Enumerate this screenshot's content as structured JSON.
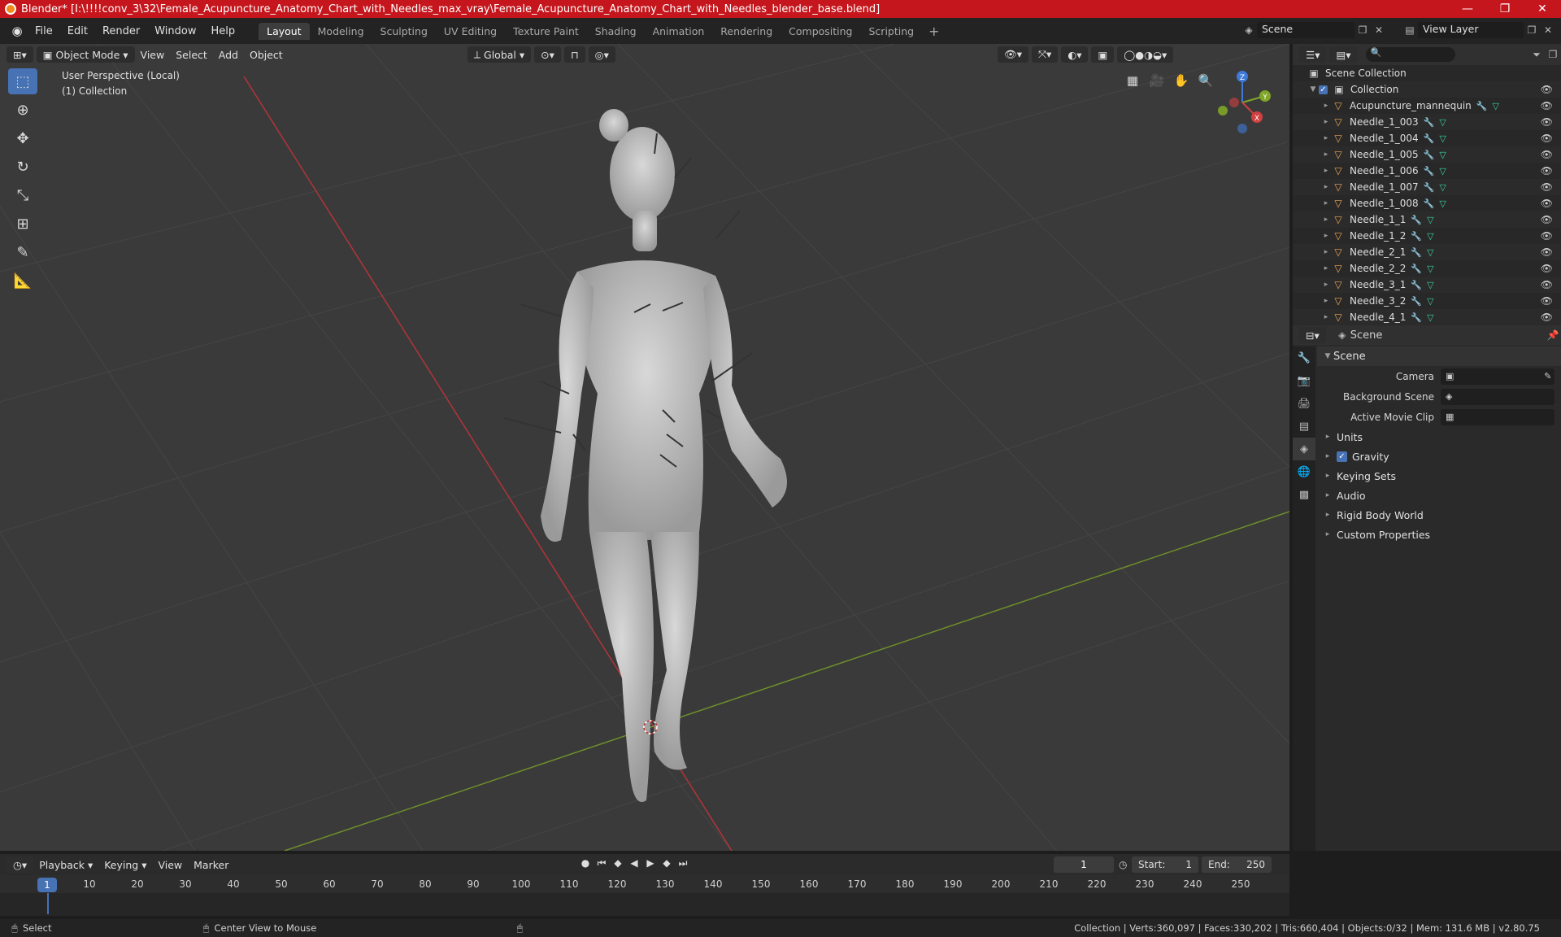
{
  "titlebar": {
    "title": "Blender* [I:\\!!!!conv_3\\32\\Female_Acupuncture_Anatomy_Chart_with_Needles_max_vray\\Female_Acupuncture_Anatomy_Chart_with_Needles_blender_base.blend]",
    "minimize": "—",
    "maximize": "❐",
    "close": "✕"
  },
  "menubar": {
    "items": [
      "File",
      "Edit",
      "Render",
      "Window",
      "Help"
    ],
    "tabs": [
      "Layout",
      "Modeling",
      "Sculpting",
      "UV Editing",
      "Texture Paint",
      "Shading",
      "Animation",
      "Rendering",
      "Compositing",
      "Scripting"
    ],
    "active_tab": "Layout",
    "scene": "Scene",
    "view_layer": "View Layer"
  },
  "viewport": {
    "mode": "Object Mode",
    "menus": [
      "View",
      "Select",
      "Add",
      "Object"
    ],
    "orientation": "Global",
    "perspective": "User Perspective (Local)",
    "collection": "(1) Collection",
    "gizmo_axes": [
      "X",
      "Y",
      "Z"
    ]
  },
  "outliner": {
    "search_placeholder": "",
    "scene_collection": "Scene Collection",
    "collection": "Collection",
    "objects": [
      "Acupuncture_mannequin",
      "Needle_1_003",
      "Needle_1_004",
      "Needle_1_005",
      "Needle_1_006",
      "Needle_1_007",
      "Needle_1_008",
      "Needle_1_1",
      "Needle_1_2",
      "Needle_2_1",
      "Needle_2_2",
      "Needle_3_1",
      "Needle_3_2",
      "Needle_4_1"
    ]
  },
  "properties": {
    "context": "Scene",
    "panel_title": "Scene",
    "camera_label": "Camera",
    "background_scene_label": "Background Scene",
    "active_movie_clip_label": "Active Movie Clip",
    "subpanels": [
      "Units",
      "Gravity",
      "Keying Sets",
      "Audio",
      "Rigid Body World",
      "Custom Properties"
    ],
    "gravity_checked": true
  },
  "timeline": {
    "menus": [
      "Playback",
      "Keying",
      "View",
      "Marker"
    ],
    "current_frame": "1",
    "start_label": "Start:",
    "start": "1",
    "end_label": "End:",
    "end": "250",
    "ticks": [
      "10",
      "20",
      "30",
      "40",
      "50",
      "60",
      "70",
      "80",
      "90",
      "100",
      "110",
      "120",
      "130",
      "140",
      "150",
      "160",
      "170",
      "180",
      "190",
      "200",
      "210",
      "220",
      "230",
      "240",
      "250"
    ],
    "frame_marker": "1"
  },
  "statusbar": {
    "left": "Select",
    "middle": "Center View to Mouse",
    "right": "Collection | Verts:360,097 | Faces:330,202 | Tris:660,404 | Objects:0/32 | Mem: 131.6 MB | v2.80.75"
  }
}
